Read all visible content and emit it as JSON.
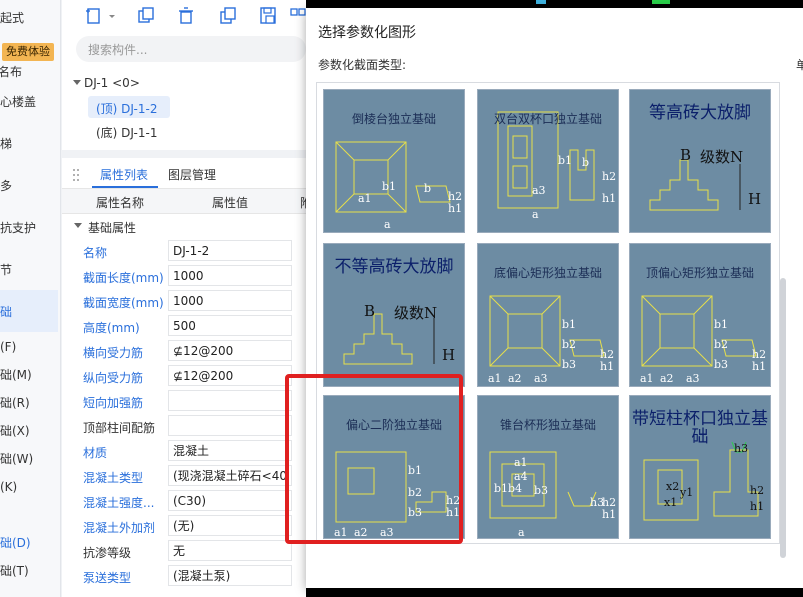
{
  "leftnav": {
    "items": [
      "起式",
      "名布",
      "心楼盖",
      "梯",
      "多",
      "抗支护",
      "节",
      "础",
      "(F)",
      "础(M)",
      "础(R)",
      "础(X)",
      "础(W)",
      "(K)",
      "础(D)",
      "础(T)"
    ],
    "badge": "免费体验"
  },
  "search": {
    "placeholder": "搜索构件..."
  },
  "tree": {
    "root": "DJ-1 <0>",
    "top": "(顶) DJ-1-2",
    "bottom": "(底) DJ-1-1"
  },
  "tabs": {
    "props": "属性列表",
    "layers": "图层管理"
  },
  "table": {
    "col_name": "属性名称",
    "col_value": "属性值",
    "col_extra": "附",
    "group": "基础属性",
    "rows": [
      {
        "k": "名称",
        "v": "DJ-1-2",
        "blue": true
      },
      {
        "k": "截面长度(mm)",
        "v": "1000",
        "blue": true
      },
      {
        "k": "截面宽度(mm)",
        "v": "1000",
        "blue": true
      },
      {
        "k": "高度(mm)",
        "v": "500",
        "blue": true
      },
      {
        "k": "横向受力筋",
        "v": "⊈12@200",
        "blue": true
      },
      {
        "k": "纵向受力筋",
        "v": "⊈12@200",
        "blue": true
      },
      {
        "k": "短向加强筋",
        "v": "",
        "blue": true
      },
      {
        "k": "顶部柱间配筋",
        "v": "",
        "blue": false
      },
      {
        "k": "材质",
        "v": "混凝土",
        "blue": true
      },
      {
        "k": "混凝土类型",
        "v": "(现浇混凝土碎石<40",
        "blue": true
      },
      {
        "k": "混凝土强度...",
        "v": "(C30)",
        "blue": true
      },
      {
        "k": "混凝土外加剂",
        "v": "(无)",
        "blue": true
      },
      {
        "k": "抗渗等级",
        "v": "无",
        "blue": false
      },
      {
        "k": "泵送类型",
        "v": "(混凝土泵)",
        "blue": true
      }
    ]
  },
  "dialog": {
    "title": "选择参数化图形",
    "subtitle": "参数化截面类型:",
    "right_label": "单",
    "cells": [
      {
        "title": "倒棱台独立基础",
        "labels": [
          "b1",
          "a1",
          "a",
          "b",
          "h2",
          "h1"
        ]
      },
      {
        "title": "双台双杯口独立基础",
        "labels": [
          "b1",
          "a3",
          "b",
          "h2",
          "h1",
          "a"
        ]
      },
      {
        "title": "等高砖大放脚",
        "labels": [
          "B",
          "级数N",
          "H"
        ]
      },
      {
        "title": "不等高砖大放脚",
        "labels": [
          "B",
          "级数N",
          "H"
        ]
      },
      {
        "title": "底偏心矩形独立基础",
        "labels": [
          "b1",
          "b2",
          "b3",
          "a1",
          "a2",
          "a3",
          "h2",
          "h1"
        ]
      },
      {
        "title": "顶偏心矩形独立基础",
        "labels": [
          "b1",
          "b2",
          "b3",
          "a1",
          "a2",
          "a3",
          "h2",
          "h1"
        ]
      },
      {
        "title": "偏心二阶独立基础",
        "labels": [
          "b1",
          "b2",
          "b3",
          "a1",
          "a2",
          "a3",
          "h2",
          "h1"
        ]
      },
      {
        "title": "锥台杯形独立基础",
        "labels": [
          "a1",
          "a4",
          "b1",
          "b4",
          "b3",
          "a",
          "h3",
          "h2",
          "h1"
        ]
      },
      {
        "title": "带短柱杯口独立基础",
        "labels": [
          "x2",
          "x1",
          "y1",
          "h3",
          "h2",
          "h1"
        ]
      }
    ]
  },
  "colors": {
    "accent": "#2a6fdb",
    "highlight": "#e02020",
    "cell_bg": "#6d8ca3",
    "line": "#e8e04a"
  }
}
